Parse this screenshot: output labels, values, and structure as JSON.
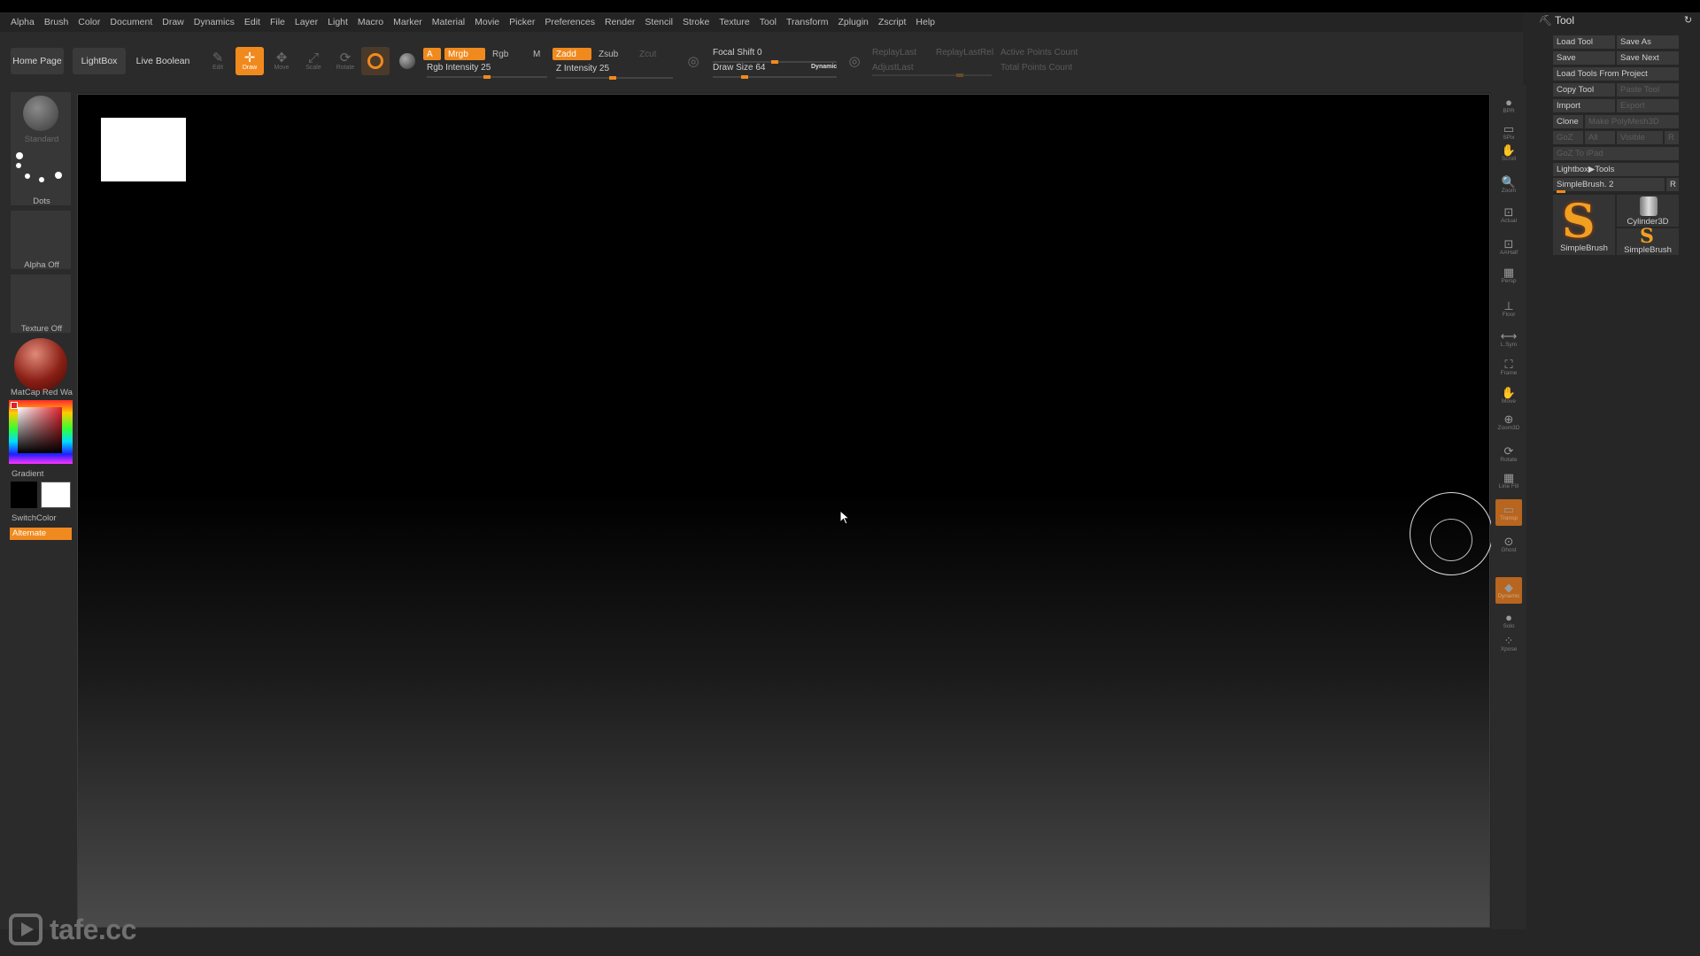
{
  "menu": [
    "Alpha",
    "Brush",
    "Color",
    "Document",
    "Draw",
    "Dynamics",
    "Edit",
    "File",
    "Layer",
    "Light",
    "Macro",
    "Marker",
    "Material",
    "Movie",
    "Picker",
    "Preferences",
    "Render",
    "Stencil",
    "Stroke",
    "Texture",
    "Tool",
    "Transform",
    "Zplugin",
    "Zscript",
    "Help"
  ],
  "shelf": {
    "home_page": "Home Page",
    "lightbox": "LightBox",
    "live_boolean": "Live Boolean",
    "modes": [
      {
        "label": "Edit",
        "icon": "edit-icon",
        "active": false
      },
      {
        "label": "Draw",
        "icon": "draw-icon",
        "active": true
      },
      {
        "label": "Move",
        "icon": "move-icon",
        "active": false
      },
      {
        "label": "Scale",
        "icon": "scale-icon",
        "active": false
      },
      {
        "label": "Rotate",
        "icon": "rotate-icon",
        "active": false
      }
    ],
    "a_label": "A",
    "mrgb": "Mrgb",
    "rgb": "Rgb",
    "m": "M",
    "zadd": "Zadd",
    "zsub": "Zsub",
    "zcut": "Zcut",
    "rgb_intensity": {
      "label": "Rgb Intensity 25",
      "value": 25
    },
    "z_intensity": {
      "label": "Z Intensity 25",
      "value": 25
    },
    "focal_shift": {
      "label": "Focal Shift 0",
      "value": 0
    },
    "draw_size": {
      "label": "Draw Size 64",
      "value": 64
    },
    "dynamic": "Dynamic",
    "replay_last": "ReplayLast",
    "replay_last_rel": "ReplayLastRel",
    "adjust_last": "AdjustLast",
    "active_points": "Active Points Count",
    "total_points": "Total Points Count"
  },
  "left_tray": {
    "brush": "Standard",
    "stroke": "Dots",
    "alpha": "Alpha Off",
    "texture": "Texture Off",
    "material": "MatCap Red Wax",
    "gradient": "Gradient",
    "switch_color": "SwitchColor",
    "alternate": "Alternate"
  },
  "right_shelf": [
    "BPR",
    "SPix",
    "Scroll",
    "Zoom",
    "Actual",
    "AAHalf",
    "Persp",
    "Floor",
    "L.Sym",
    "Frame",
    "Move",
    "Zoom3D",
    "Rotate",
    "Line Fill",
    "Transp",
    "Ghost",
    "Dynamic",
    "Solo",
    "Xpose"
  ],
  "tool_panel": {
    "title": "Tool",
    "load_tool": "Load Tool",
    "save_as": "Save As",
    "save": "Save",
    "save_next": "Save Next",
    "load_from_project": "Load Tools From Project",
    "copy_tool": "Copy Tool",
    "paste_tool": "Paste Tool",
    "import": "Import",
    "export": "Export",
    "clone": "Clone",
    "make_polymesh": "Make PolyMesh3D",
    "goz": "GoZ",
    "all": "All",
    "visible": "Visible",
    "r": "R",
    "goz_ipad": "GoZ To iPad",
    "lightbox_tools": "Lightbox▶Tools",
    "current_tool": "SimpleBrush. 2",
    "current_r": "R",
    "tiles": [
      "SimpleBrush",
      "Cylinder3D",
      "SimpleBrush"
    ]
  },
  "watermark": "tafe.cc",
  "colors": {
    "accent": "#f08a1e",
    "canvas": "#000000",
    "ui": "#2b2b2b"
  }
}
